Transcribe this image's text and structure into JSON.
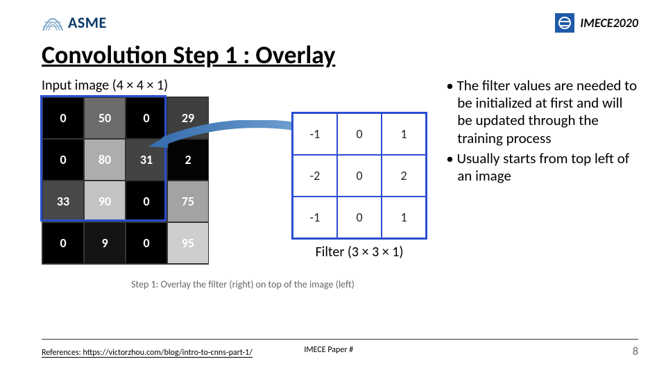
{
  "header": {
    "asme_text": "ASME",
    "imece_text": "IMECE2020"
  },
  "title": "Convolution Step 1 : Overlay",
  "input_label": "Input image (4 × 4 × 1)",
  "image_values": [
    [
      0,
      50,
      0,
      29
    ],
    [
      0,
      80,
      31,
      2
    ],
    [
      33,
      90,
      0,
      75
    ],
    [
      0,
      9,
      0,
      95
    ]
  ],
  "filter_values": [
    [
      -1,
      0,
      1
    ],
    [
      -2,
      0,
      2
    ],
    [
      -1,
      0,
      1
    ]
  ],
  "filter_label": "Filter (3 × 3 × 1)",
  "step_caption": "Step 1: Overlay the filter (right) on top of the image (left)",
  "bullets": [
    "The filter values are needed to be initialized at first and will be updated through the training process",
    "Usually starts from top left of an image"
  ],
  "footer": {
    "references_prefix": "References: ",
    "references_url": "https://victorzhou.com/blog/intro-to-cnns-part-1/",
    "paper_label": "IMECE Paper #",
    "page_number": "8"
  }
}
